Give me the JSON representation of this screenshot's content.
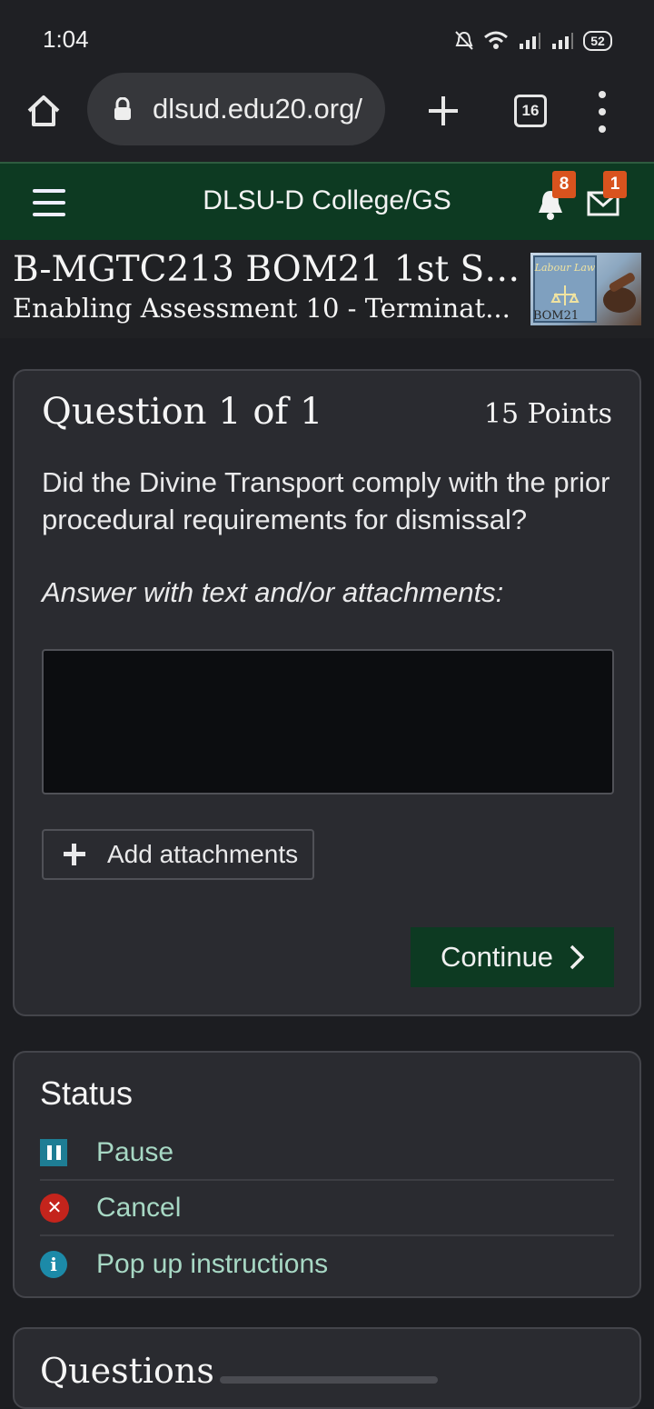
{
  "statusbar": {
    "time": "1:04",
    "battery": "52"
  },
  "browser": {
    "url": "dlsud.edu20.org/",
    "tab_count": "16"
  },
  "site": {
    "title": "DLSU-D College/GS",
    "notifications_count": "8",
    "messages_count": "1"
  },
  "course": {
    "title": "B-MGTC213 BOM21 1st Sem (...",
    "subtitle": "Enabling Assessment 10 - Terminat...",
    "thumbnail": {
      "label_top": "Labour Law",
      "label_bottom": "BOM21"
    }
  },
  "question": {
    "heading": "Question 1 of 1",
    "points": "15 Points",
    "text": "Did the Divine Transport comply with the prior procedural requirements for dismissal?",
    "instruction": "Answer with text and/or attachments:",
    "answer_value": "",
    "attach_label": "Add attachments",
    "continue_label": "Continue"
  },
  "status": {
    "title": "Status",
    "items": [
      {
        "label": "Pause",
        "icon": "pause-icon"
      },
      {
        "label": "Cancel",
        "icon": "cancel-icon"
      },
      {
        "label": "Pop up instructions",
        "icon": "info-icon"
      }
    ]
  },
  "questions_panel": {
    "title": "Questions"
  },
  "colors": {
    "brand_green": "#0d3a22",
    "badge_orange": "#d9531e",
    "link_green": "#a7d8c4"
  }
}
